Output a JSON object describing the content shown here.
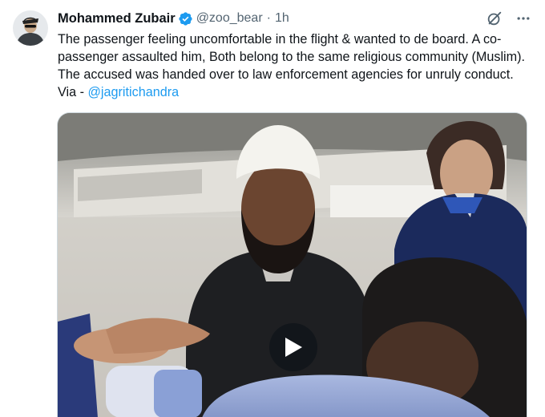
{
  "tweet": {
    "author": {
      "name": "Mohammed Zubair",
      "handle": "@zoo_bear",
      "separator": "·",
      "time": "1h",
      "verified_color": "#1d9bf0"
    },
    "text": "The passenger feeling uncomfortable in the flight & wanted to de board. A co-passenger assaulted him, Both belong to the same religious community (Muslim). The accused was handed over to law enforcement agencies for unruly conduct. Via - ",
    "mention": "@jagritichandra",
    "actions": {
      "grok_icon": "grok-icon",
      "more_icon": "more-icon"
    },
    "media": {
      "type": "video",
      "play_icon": "play-icon"
    }
  },
  "colors": {
    "text": "#0f1419",
    "secondary": "#536471",
    "link": "#1d9bf0",
    "border": "#cfd9de"
  }
}
